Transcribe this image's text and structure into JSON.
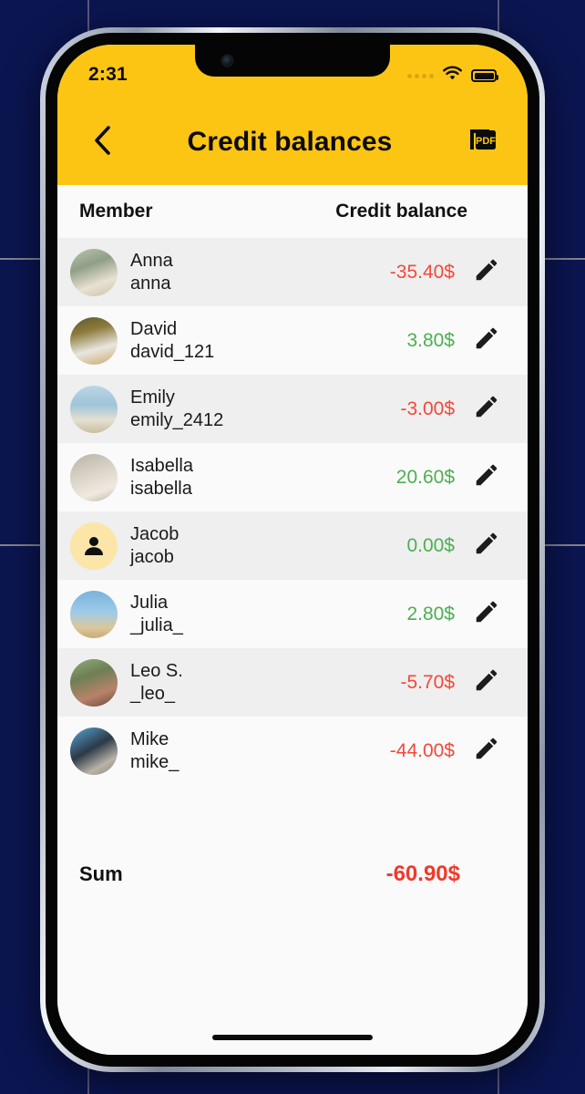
{
  "background": {
    "color": "#0b1550"
  },
  "status_bar": {
    "time": "2:31",
    "signal_icon": "signal-dots-icon",
    "wifi_icon": "wifi-icon",
    "battery_icon": "battery-full-icon"
  },
  "app_bar": {
    "back_icon": "chevron-left-icon",
    "title": "Credit balances",
    "pdf_icon": "pdf-export-icon",
    "color": "#fdc513"
  },
  "table": {
    "columns": {
      "member": "Member",
      "balance": "Credit balance"
    },
    "edit_icon": "pencil-icon",
    "rows": [
      {
        "name": "Anna",
        "handle": "anna",
        "balance": "-35.40$",
        "sign": "neg",
        "avatar": "photo"
      },
      {
        "name": "David",
        "handle": "david_121",
        "balance": "3.80$",
        "sign": "pos",
        "avatar": "photo"
      },
      {
        "name": "Emily",
        "handle": "emily_2412",
        "balance": "-3.00$",
        "sign": "neg",
        "avatar": "photo"
      },
      {
        "name": "Isabella",
        "handle": "isabella",
        "balance": "20.60$",
        "sign": "pos",
        "avatar": "photo"
      },
      {
        "name": "Jacob",
        "handle": "jacob",
        "balance": "0.00$",
        "sign": "pos",
        "avatar": "placeholder"
      },
      {
        "name": "Julia",
        "handle": "_julia_",
        "balance": "2.80$",
        "sign": "pos",
        "avatar": "photo"
      },
      {
        "name": "Leo S.",
        "handle": "_leo_",
        "balance": "-5.70$",
        "sign": "neg",
        "avatar": "photo"
      },
      {
        "name": "Mike",
        "handle": "mike_",
        "balance": "-44.00$",
        "sign": "neg",
        "avatar": "photo"
      }
    ]
  },
  "summary": {
    "label": "Sum",
    "value": "-60.90$",
    "color": "#f0392b"
  },
  "colors": {
    "negative": "#f4483a",
    "positive": "#4caf50",
    "accent": "#fdc513"
  },
  "home_indicator": "home-bar"
}
